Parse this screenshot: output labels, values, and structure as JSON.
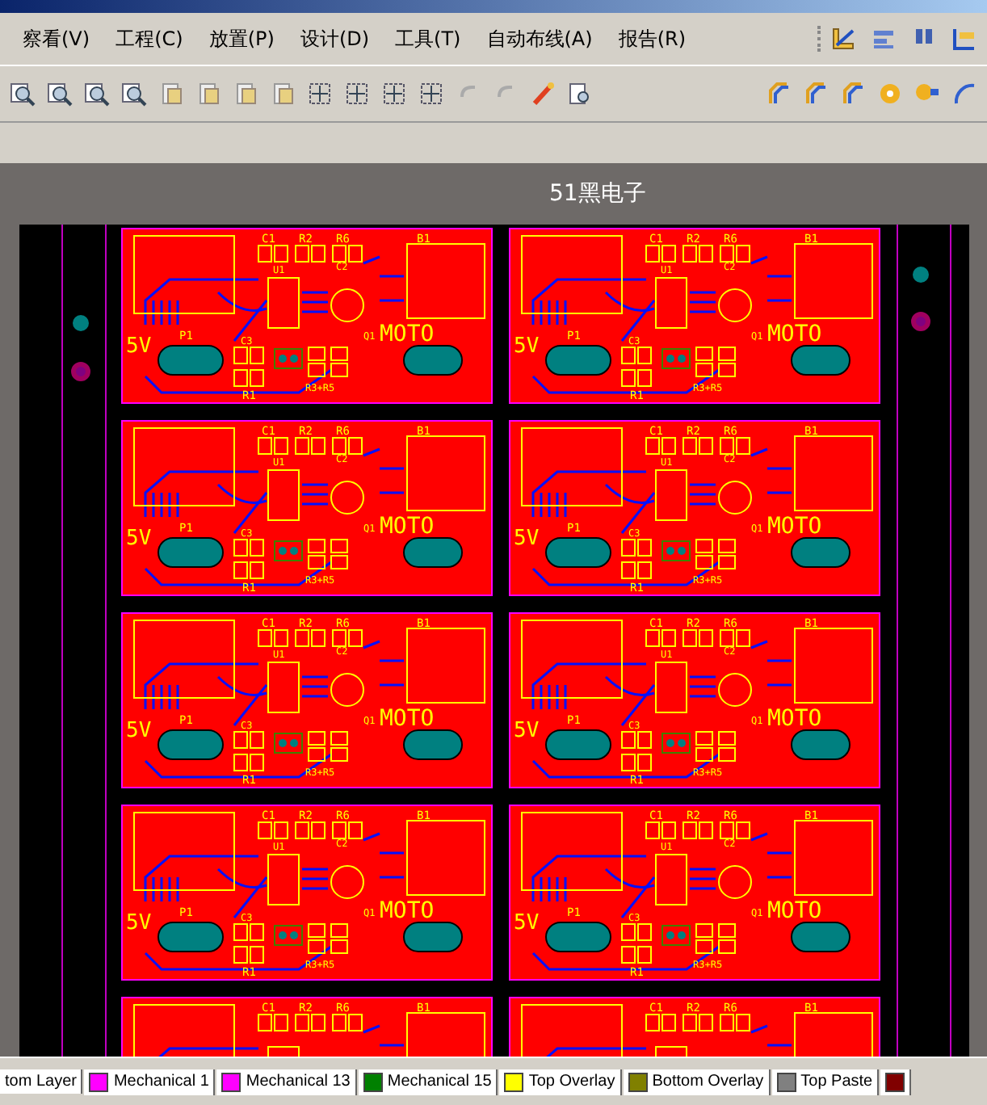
{
  "menu": [
    {
      "label": "察看(V)"
    },
    {
      "label": "工程(C)"
    },
    {
      "label": "放置(P)"
    },
    {
      "label": "设计(D)"
    },
    {
      "label": "工具(T)"
    },
    {
      "label": "自动布线(A)"
    },
    {
      "label": "报告(R)"
    }
  ],
  "canvas": {
    "title": "51黑电子",
    "boards": [
      {
        "labels": [
          "C1",
          "R2",
          "R6",
          "B1",
          "U1",
          "C2",
          "5V",
          "P1",
          "C3",
          "R1",
          "R3+R5",
          "Q1",
          "MOTO"
        ]
      },
      {
        "labels": [
          "C1",
          "R2",
          "R6",
          "B1",
          "U1",
          "C2",
          "5V",
          "P1",
          "C3",
          "R1",
          "R3+R5",
          "Q1",
          "MOTO"
        ]
      },
      {
        "labels": [
          "C1",
          "R2",
          "R6",
          "B1",
          "U1",
          "C2",
          "5V",
          "P1",
          "C3",
          "R1",
          "R3+R5",
          "Q1",
          "MOTO"
        ]
      },
      {
        "labels": [
          "C1",
          "R2",
          "R6",
          "B1",
          "U1",
          "C2",
          "5V",
          "P1",
          "C3",
          "R1",
          "R3+R5",
          "Q1",
          "MOTO"
        ]
      },
      {
        "labels": [
          "C1",
          "R2",
          "R6",
          "B1",
          "U1",
          "C2",
          "5V",
          "P1",
          "C3",
          "R1",
          "R3+R5",
          "Q1",
          "MOTO"
        ]
      },
      {
        "labels": [
          "C1",
          "R2",
          "R6",
          "B1",
          "U1",
          "C2",
          "5V",
          "P1",
          "C3",
          "R1",
          "R3+R5",
          "Q1",
          "MOTO"
        ]
      },
      {
        "labels": [
          "C1",
          "R2",
          "R6",
          "B1",
          "U1",
          "C2",
          "5V",
          "P1",
          "C3",
          "R1",
          "R3+R5",
          "Q1",
          "MOTO"
        ]
      },
      {
        "labels": [
          "C1",
          "R2",
          "R6",
          "B1",
          "U1",
          "C2",
          "5V",
          "P1",
          "C3",
          "R1",
          "R3+R5",
          "Q1",
          "MOTO"
        ]
      },
      {
        "labels": [
          "C1",
          "R2",
          "R6",
          "B1"
        ]
      },
      {
        "labels": [
          "C1",
          "R2",
          "R6",
          "B1"
        ]
      }
    ]
  },
  "layer_tabs": [
    {
      "label": "tom Layer"
    },
    {
      "label": "Mechanical 1",
      "color": "#ff00ff"
    },
    {
      "label": "Mechanical 13",
      "color": "#ff00ff"
    },
    {
      "label": "Mechanical 15",
      "color": "#008000"
    },
    {
      "label": "Top Overlay",
      "color": "#ffff00"
    },
    {
      "label": "Bottom Overlay",
      "color": "#808000"
    },
    {
      "label": "Top Paste",
      "color": "#808080"
    },
    {
      "color": "#800000"
    }
  ]
}
